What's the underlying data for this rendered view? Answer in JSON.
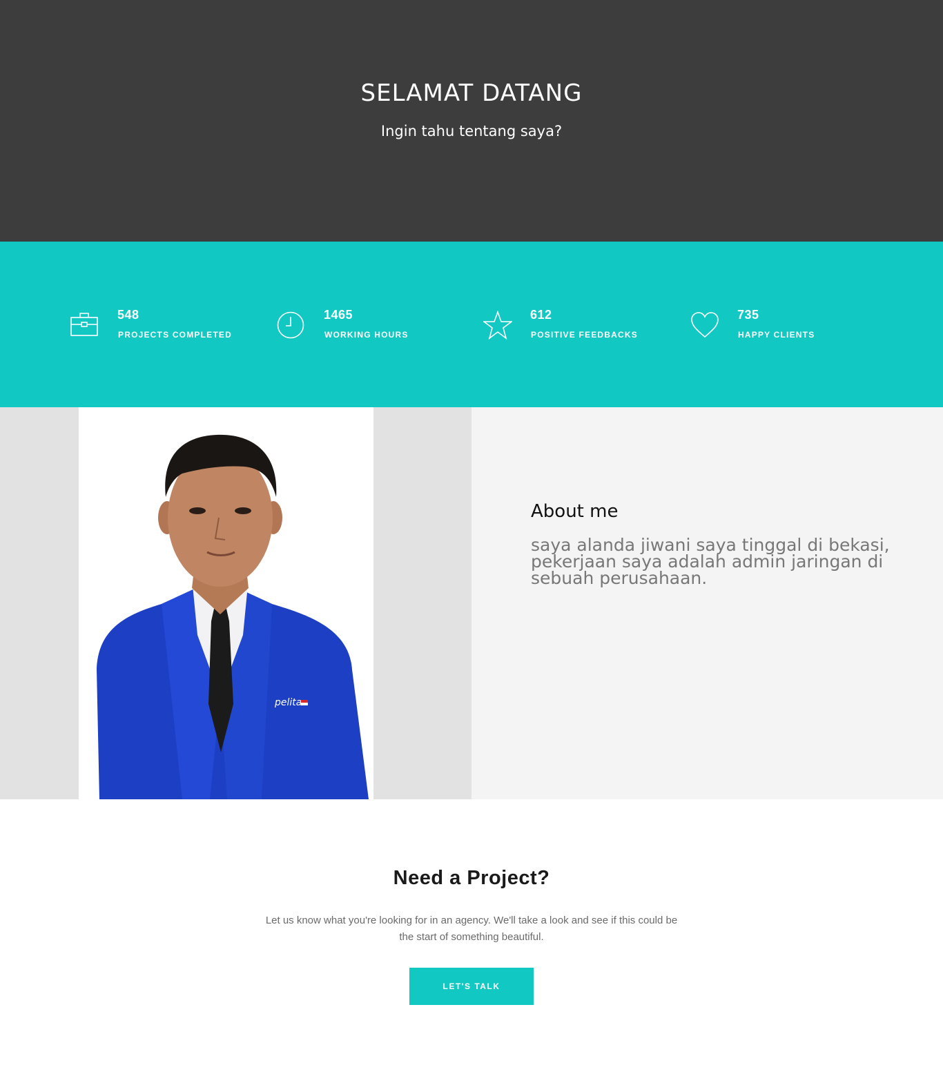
{
  "hero": {
    "title": "SELAMAT DATANG",
    "subtitle": "Ingin tahu tentang saya?"
  },
  "stats": [
    {
      "icon": "briefcase-icon",
      "value": "548",
      "label": "PROJECTS COMPLETED"
    },
    {
      "icon": "clock-icon",
      "value": "1465",
      "label": "WORKING HOURS"
    },
    {
      "icon": "star-icon",
      "value": "612",
      "label": "POSITIVE FEEDBACKS"
    },
    {
      "icon": "heart-icon",
      "value": "735",
      "label": "HAPPY CLIENTS"
    }
  ],
  "about": {
    "heading": "About me",
    "bio": "saya alanda jiwani saya tinggal di bekasi, pekerjaan saya adalah admin jaringan di sebuah perusahaan.",
    "badge": "pelita"
  },
  "cta": {
    "heading": "Need a Project?",
    "text": "Let us know what you're looking for in an agency. We'll take a look and see if this could be the start of something beautiful.",
    "button": "LET'S TALK"
  },
  "colors": {
    "hero_bg": "#3d3d3d",
    "accent": "#11c8c2",
    "about_left_bg": "#e2e2e2",
    "about_right_bg": "#f4f4f4"
  }
}
